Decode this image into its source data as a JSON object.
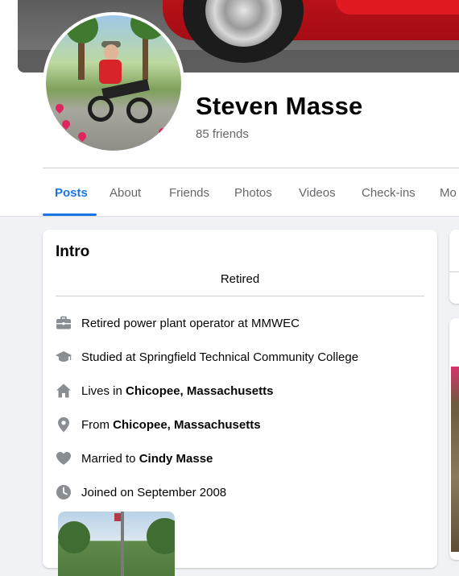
{
  "profile": {
    "name": "Steven Masse",
    "friends": "85 friends"
  },
  "tabs": [
    {
      "label": "Posts",
      "active": true
    },
    {
      "label": "About"
    },
    {
      "label": "Friends"
    },
    {
      "label": "Photos"
    },
    {
      "label": "Videos"
    },
    {
      "label": "Check-ins"
    },
    {
      "label": "Mo"
    }
  ],
  "intro": {
    "title": "Intro",
    "bio": "Retired",
    "details": [
      {
        "icon": "briefcase-icon",
        "prefix": "Retired power plant operator at MMWEC",
        "bold": ""
      },
      {
        "icon": "graduation-cap-icon",
        "prefix": "Studied at Springfield Technical Community College",
        "bold": ""
      },
      {
        "icon": "home-icon",
        "prefix": "Lives in ",
        "bold": "Chicopee, Massachusetts"
      },
      {
        "icon": "location-pin-icon",
        "prefix": "From ",
        "bold": "Chicopee, Massachusetts"
      },
      {
        "icon": "heart-icon",
        "prefix": "Married to ",
        "bold": "Cindy Masse"
      },
      {
        "icon": "clock-icon",
        "prefix": "Joined on September 2008",
        "bold": ""
      }
    ]
  },
  "colors": {
    "accent": "#1b74e4",
    "secondary_text": "#65676b",
    "icon_gray": "#8a8d91"
  }
}
